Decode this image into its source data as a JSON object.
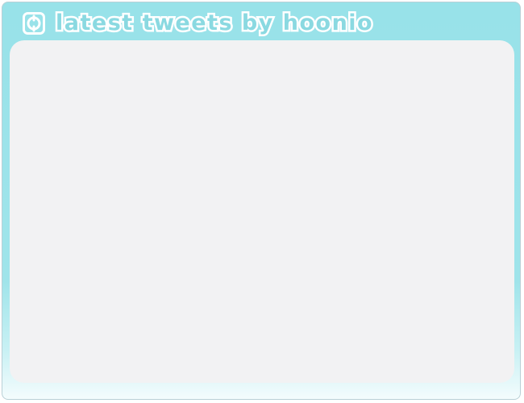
{
  "widget": {
    "title": "latest tweets by hoonio",
    "logo_icon": "twitter-bird-icon"
  },
  "colors": {
    "frame": "#98e2e9",
    "panel": "#f2f2f3",
    "title_text": "#ffffff"
  }
}
